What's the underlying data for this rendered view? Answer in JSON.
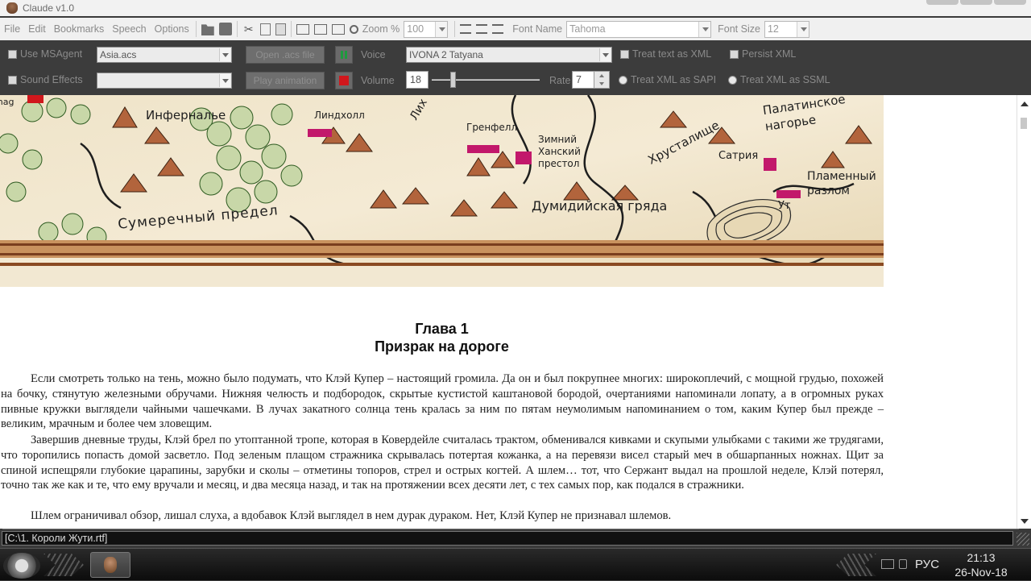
{
  "window": {
    "title": "Claude v1.0"
  },
  "menu": {
    "items": [
      "File",
      "Edit",
      "Bookmarks",
      "Speech",
      "Options"
    ],
    "zoom_label": "Zoom %",
    "zoom_value": "100",
    "font_name_label": "Font Name",
    "font_name_value": "Tahoma",
    "font_size_label": "Font Size",
    "font_size_value": "12"
  },
  "panel": {
    "use_msagent_label": "Use MSAgent",
    "agent_file": "Asia.acs",
    "open_acs_label": "Open .acs file",
    "voice_label": "Voice",
    "voice_value": "IVONA 2 Tatyana",
    "treat_text_xml_label": "Treat text as XML",
    "persist_xml_label": "Persist XML",
    "sound_effects_label": "Sound Effects",
    "animation_value": "",
    "play_animation_label": "Play animation",
    "volume_label": "Volume",
    "volume_value": "18",
    "volume_level": 0.18,
    "rate_label": "Rate",
    "rate_value": "7",
    "treat_xml_sapi_label": "Treat XML as SAPI",
    "treat_xml_ssml_label": "Treat XML as SSML"
  },
  "map": {
    "labels": {
      "nag": "onag",
      "infernale": "Инферналье",
      "lindxoll": "Линдхолл",
      "lix": "Лих",
      "grenfell": "Гренфелл",
      "throne": "Зимний\nХанский\nпрестол",
      "hrustalishe": "Хрусталище",
      "satriya": "Сатрия",
      "palatinskoe": "Палатинское\nнагорье",
      "plamenny": "Пламенный\nразлом",
      "ut": "Ут",
      "sumerechny": "Сумеречный предел",
      "dumidiyskaya": "Думидийская гряда"
    }
  },
  "document": {
    "chapter_number": "Глава 1",
    "chapter_title": "Призрак на дороге",
    "paragraphs": [
      "Если смотреть только на тень, можно было подумать, что Клэй Купер – настоящий громила. Да он и был покрупнее многих: широкоплечий, с мощной грудью, похожей на бочку, стянутую железными обручами. Нижняя челюсть и подбородок, скрытые кустистой каштановой бородой, очертаниями напоминали лопату, а в огромных руках пивные кружки выглядели чайными чашечками. В лучах закатного солнца тень кралась за ним по пятам неумолимым напоминанием о том, каким Купер был прежде – великим, мрачным и более чем зловещим.",
      "Завершив дневные труды, Клэй брел по утоптанной тропе, которая в Ковердейле считалась трактом, обменивался кивками и скупыми улыбками с такими же трудягами, что торопились попасть домой засветло. Под зеленым плащом стражника скрывалась потертая кожанка, а на перевязи висел старый меч в обшарпанных ножнах. Щит за спиной испещряли глубокие царапины, зарубки и сколы – отметины топоров, стрел и острых когтей. А шлем… тот, что Сержант выдал на прошлой неделе, Клэй потерял, точно так же как и те, что ему вручали и месяц, и два месяца назад, и так на протяжении всех десяти лет, с тех самых пор, как подался в стражники.",
      "Шлем ограничивал обзор, лишал слуха, а вдобавок Клэй выглядел в нем дурак дураком. Нет, Клэй Купер не признавал шлемов."
    ]
  },
  "status": {
    "path": "[C:\\1. Короли Жути.rtf]"
  },
  "taskbar": {
    "lang": "РУС",
    "time": "21:13",
    "date": "26-Nov-18"
  }
}
